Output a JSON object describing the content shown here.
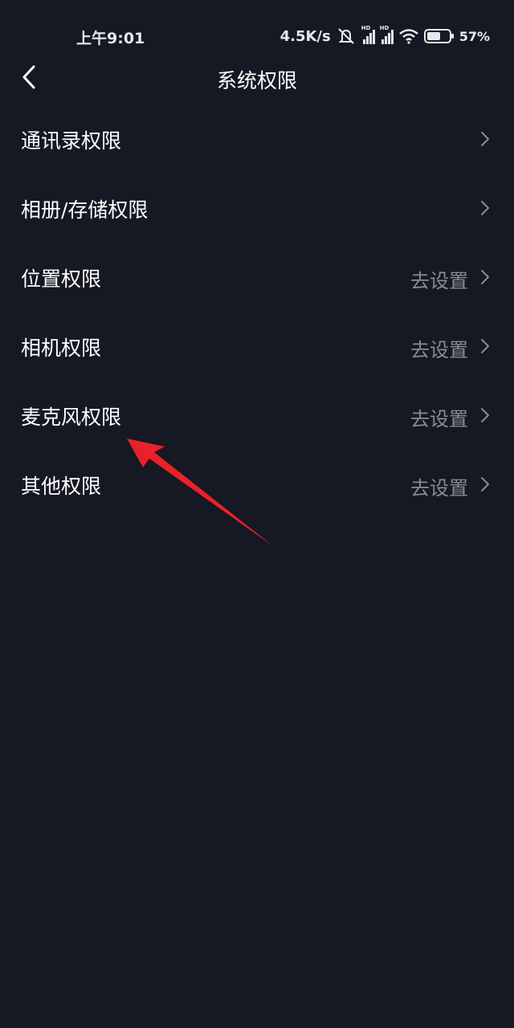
{
  "status_bar": {
    "time": "上午9:01",
    "net_speed": "4.5K/s",
    "battery": "57%",
    "icons": [
      "mute-icon",
      "hd-signal-icon",
      "hd-signal-icon",
      "wifi-icon",
      "battery-icon"
    ]
  },
  "nav": {
    "title": "系统权限",
    "back_icon": "chevron-left-icon"
  },
  "permissions": [
    {
      "label": "通讯录权限",
      "action": ""
    },
    {
      "label": "相册/存储权限",
      "action": ""
    },
    {
      "label": "位置权限",
      "action": "去设置"
    },
    {
      "label": "相机权限",
      "action": "去设置"
    },
    {
      "label": "麦克风权限",
      "action": "去设置"
    },
    {
      "label": "其他权限",
      "action": "去设置"
    }
  ],
  "colors": {
    "background": "#161823",
    "text_primary": "#ffffff",
    "text_secondary": "#8a8b93",
    "annotation_arrow": "#e8212a"
  }
}
